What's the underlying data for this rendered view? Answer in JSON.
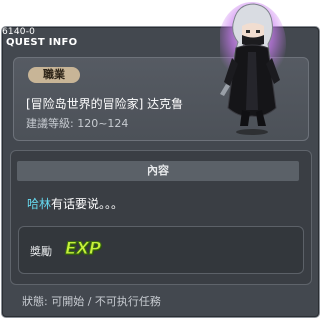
{
  "window": {
    "quest_id": "6140-0",
    "title": "QUEST INFO"
  },
  "header": {
    "job_badge": "職業",
    "quest_name": "[冒险岛世界的冒险家] 达克鲁",
    "level_range": "建議等級: 120~124"
  },
  "content": {
    "section_title": "內容",
    "npc_name": "哈林",
    "description": "有话要说。。。"
  },
  "reward": {
    "label": "獎勵",
    "icon_text": "EXP"
  },
  "status": {
    "text": "狀態: 可開始 / 不可执行任務"
  },
  "colors": {
    "window_bg": "#43484f",
    "npc_name": "#66d9ef",
    "exp_icon": "#c7f23a",
    "job_badge": "#c8b597",
    "character_glow": "#c97cf0"
  },
  "icons": {
    "character": "night-walker-character-sprite",
    "exp": "exp-icon"
  }
}
